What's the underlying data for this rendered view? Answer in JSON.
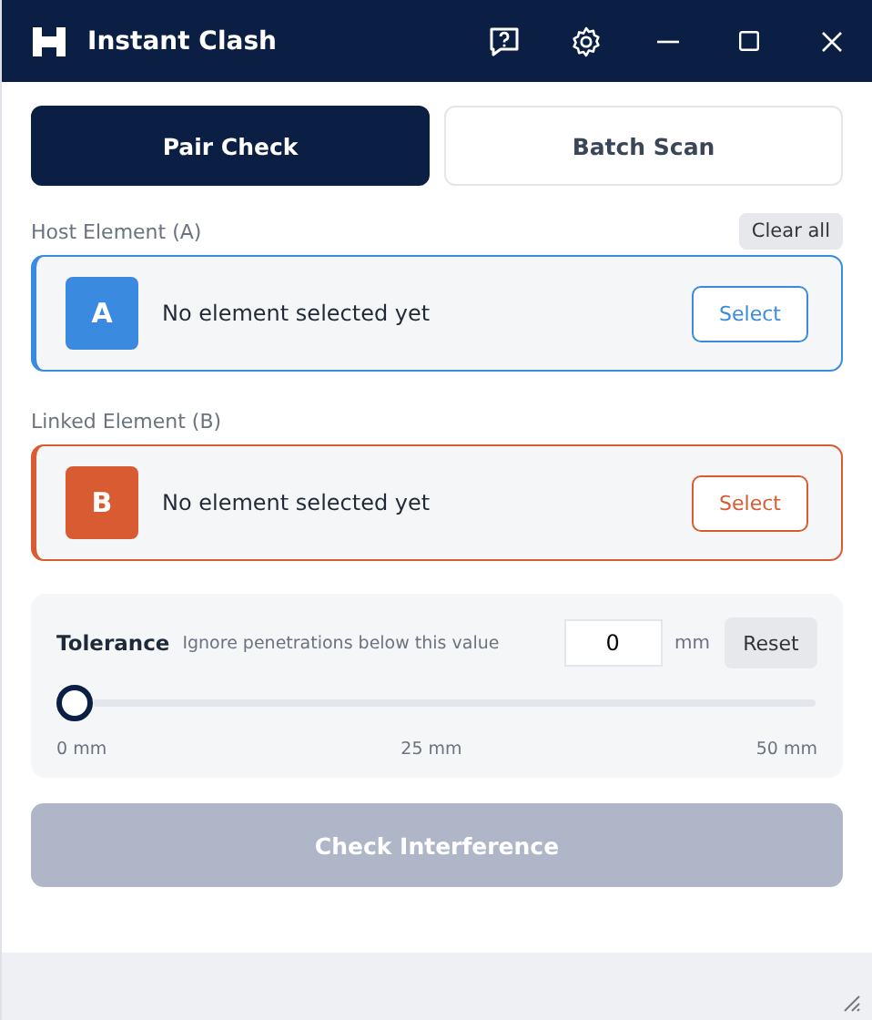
{
  "window": {
    "title": "Instant Clash"
  },
  "tabs": [
    {
      "label": "Pair Check",
      "selected": true
    },
    {
      "label": "Batch Scan",
      "selected": false
    }
  ],
  "clear_button": "Clear all",
  "elements": [
    {
      "section_label": "Host Element (A)",
      "letter": "A",
      "status": "No element selected yet",
      "button": "Select",
      "color": "#3a8ae0"
    },
    {
      "section_label": "Linked Element (B)",
      "letter": "B",
      "status": "No element selected yet",
      "button": "Select",
      "color": "#d95b31"
    }
  ],
  "tolerance": {
    "label": "Tolerance",
    "hint": "Ignore penetrations below this value",
    "value": "0",
    "unit": "mm",
    "reset": "Reset",
    "level": 0,
    "ticks": [
      "0 mm",
      "25 mm",
      "50 mm"
    ]
  },
  "check_button": {
    "label": "Check Interference",
    "disabled": true
  }
}
